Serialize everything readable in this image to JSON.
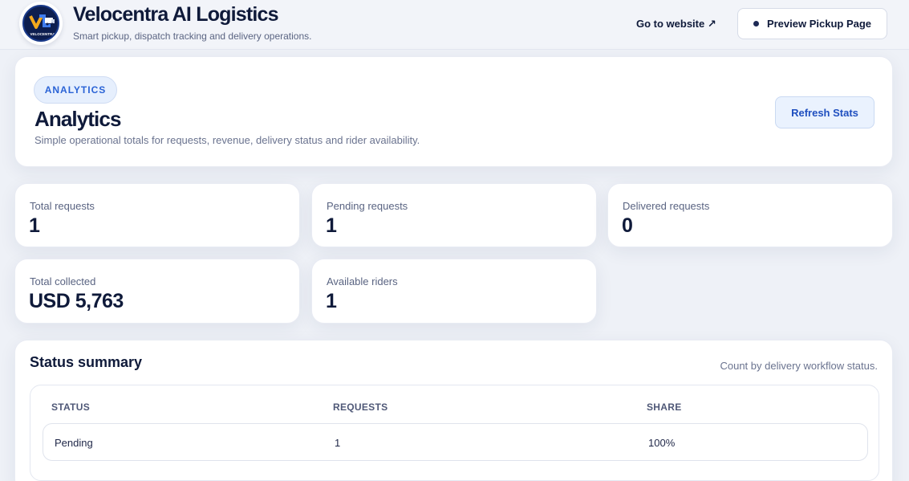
{
  "header": {
    "logo_text": "VELOCENTRA",
    "title": "Velocentra AI Logistics",
    "subtitle": "Smart pickup, dispatch tracking and delivery operations.",
    "goto_link": "Go to website ↗",
    "preview_button": "Preview Pickup Page"
  },
  "analytics": {
    "badge": "ANALYTICS",
    "title": "Analytics",
    "subtitle": "Simple operational totals for requests, revenue, delivery status and rider availability.",
    "refresh_button": "Refresh Stats"
  },
  "stats": [
    {
      "label": "Total requests",
      "value": "1"
    },
    {
      "label": "Pending requests",
      "value": "1"
    },
    {
      "label": "Delivered requests",
      "value": "0"
    },
    {
      "label": "Total collected",
      "value": "USD 5,763"
    },
    {
      "label": "Available riders",
      "value": "1"
    }
  ],
  "summary": {
    "title": "Status summary",
    "subtitle": "Count by delivery workflow status.",
    "columns": [
      "STATUS",
      "REQUESTS",
      "SHARE"
    ],
    "rows": [
      {
        "status": "Pending",
        "requests": "1",
        "share": "100%"
      }
    ]
  },
  "colors": {
    "background": "#eef1f7",
    "accent": "#2a63d6",
    "text": "#0f1a3a"
  }
}
